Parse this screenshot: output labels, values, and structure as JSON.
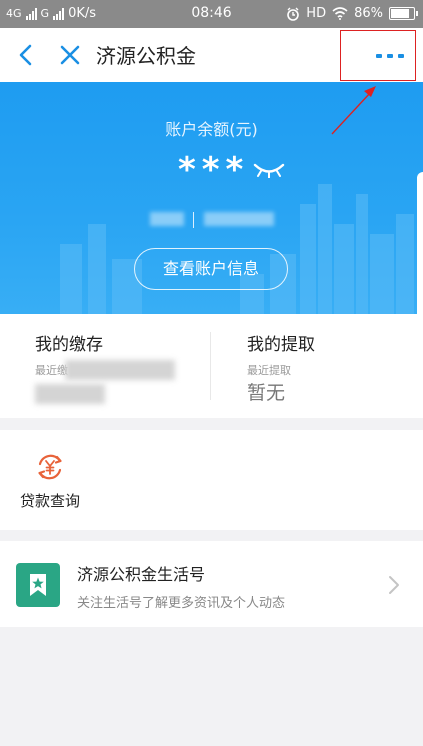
{
  "status_bar": {
    "network_1": "4G",
    "network_2": "G",
    "speed": "0K/s",
    "time": "08:46",
    "hd": "HD",
    "battery": "86%"
  },
  "nav": {
    "title": "济源公积金",
    "back_icon": "chevron-left-icon",
    "close_icon": "close-icon",
    "more_icon": "more-dots-icon"
  },
  "account": {
    "balance_label": "账户余额(元)",
    "balance_masked": "***",
    "view_button": "查看账户信息"
  },
  "stats": {
    "deposit_title": "我的缴存",
    "deposit_sub": "最近缴",
    "withdraw_title": "我的提取",
    "withdraw_sub": "最近提取",
    "withdraw_value": "暂无"
  },
  "services": {
    "loan_label": "贷款查询",
    "loan_icon": "loan-yen-icon"
  },
  "life_account": {
    "title": "济源公积金生活号",
    "description": "关注生活号了解更多资讯及个人动态",
    "icon": "bookmark-star-icon"
  },
  "colors": {
    "accent": "#1e9cf1",
    "nav_icon": "#1a8fe3",
    "loan_icon": "#e8633a",
    "life_icon": "#2aa685",
    "annotation": "#dd2222"
  }
}
